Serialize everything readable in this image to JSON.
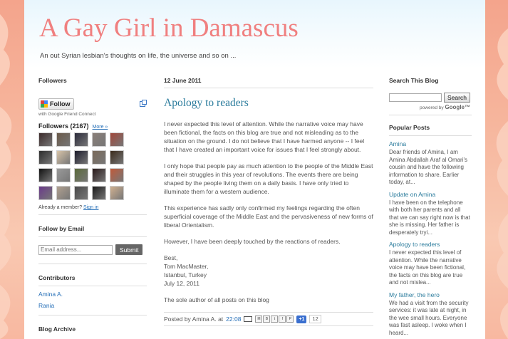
{
  "header": {
    "title": "A Gay Girl in Damascus",
    "description": "An out Syrian lesbian's thoughts on life, the universe and so on ..."
  },
  "sidebar_left": {
    "followers": {
      "title": "Followers",
      "follow_label": "Follow",
      "gfc_text": "with Google Friend Connect",
      "count_label": "Followers (2167)",
      "more_label": "More »",
      "already_text": "Already a member?",
      "sign_in": "Sign in"
    },
    "follow_email": {
      "title": "Follow by Email",
      "placeholder": "Email address...",
      "submit": "Submit"
    },
    "contributors": {
      "title": "Contributors",
      "items": [
        "Amina A.",
        "Rania"
      ]
    },
    "archive": {
      "title": "Blog Archive"
    }
  },
  "main": {
    "date": "12 June 2011",
    "post_title": "Apology to readers",
    "paragraphs": [
      "I never expected this level of attention. While the narrative voice may have been fictional, the facts on this blog are true and not misleading as to the situation on the ground. I do not believe that I have harmed anyone -- I feel that I have created an important voice for issues that I feel strongly about.",
      "I only hope that people pay as much attention to the people of the Middle East and their struggles in this year of revolutions. The events there are being shaped by the people living them on a daily basis. I have only tried to illuminate them for a western audience.",
      "This experience has sadly only confirmed my feelings regarding the often superficial coverage of the Middle East and the pervasiveness of new forms of liberal Orientalism.",
      "However, I have been deeply touched by the reactions of readers."
    ],
    "signature": [
      "Best,",
      "Tom MacMaster,",
      "Istanbul, Turkey",
      "July 12, 2011"
    ],
    "sole_author": "The sole author of all posts on this blog",
    "footer": {
      "posted_by": "Posted by Amina A. at",
      "time": "22:08",
      "share_buttons": [
        "M",
        "B",
        "t",
        "f",
        "P"
      ],
      "plusone": "+1",
      "plus_count": "12"
    }
  },
  "sidebar_right": {
    "search": {
      "title": "Search This Blog",
      "button": "Search",
      "powered_by": "powered by",
      "brand": "Google™"
    },
    "popular": {
      "title": "Popular Posts",
      "items": [
        {
          "title": "Amina",
          "snippet": "Dear friends of Amina, I am Amina Abdallah Araf al Omari's cousin and have the following information to share. Earlier today, at..."
        },
        {
          "title": "Update on Amina",
          "snippet": "I have been on the telephone with both her parents and all that we can say right now is that she is missing. Her father is desperately tryi..."
        },
        {
          "title": "Apology to readers",
          "snippet": "I never expected this level of attention. While the narrative voice may have been fictional, the facts on this blog are true and not mislea..."
        },
        {
          "title": "My father, the hero",
          "snippet": "We had a visit from the security services: it was late at night, in the wee small hours. Everyone was fast asleep. I woke when I heard..."
        }
      ]
    }
  },
  "colors": {
    "title": "#f07f7f",
    "link": "#2a7b9c",
    "background": "#f4a48c"
  }
}
